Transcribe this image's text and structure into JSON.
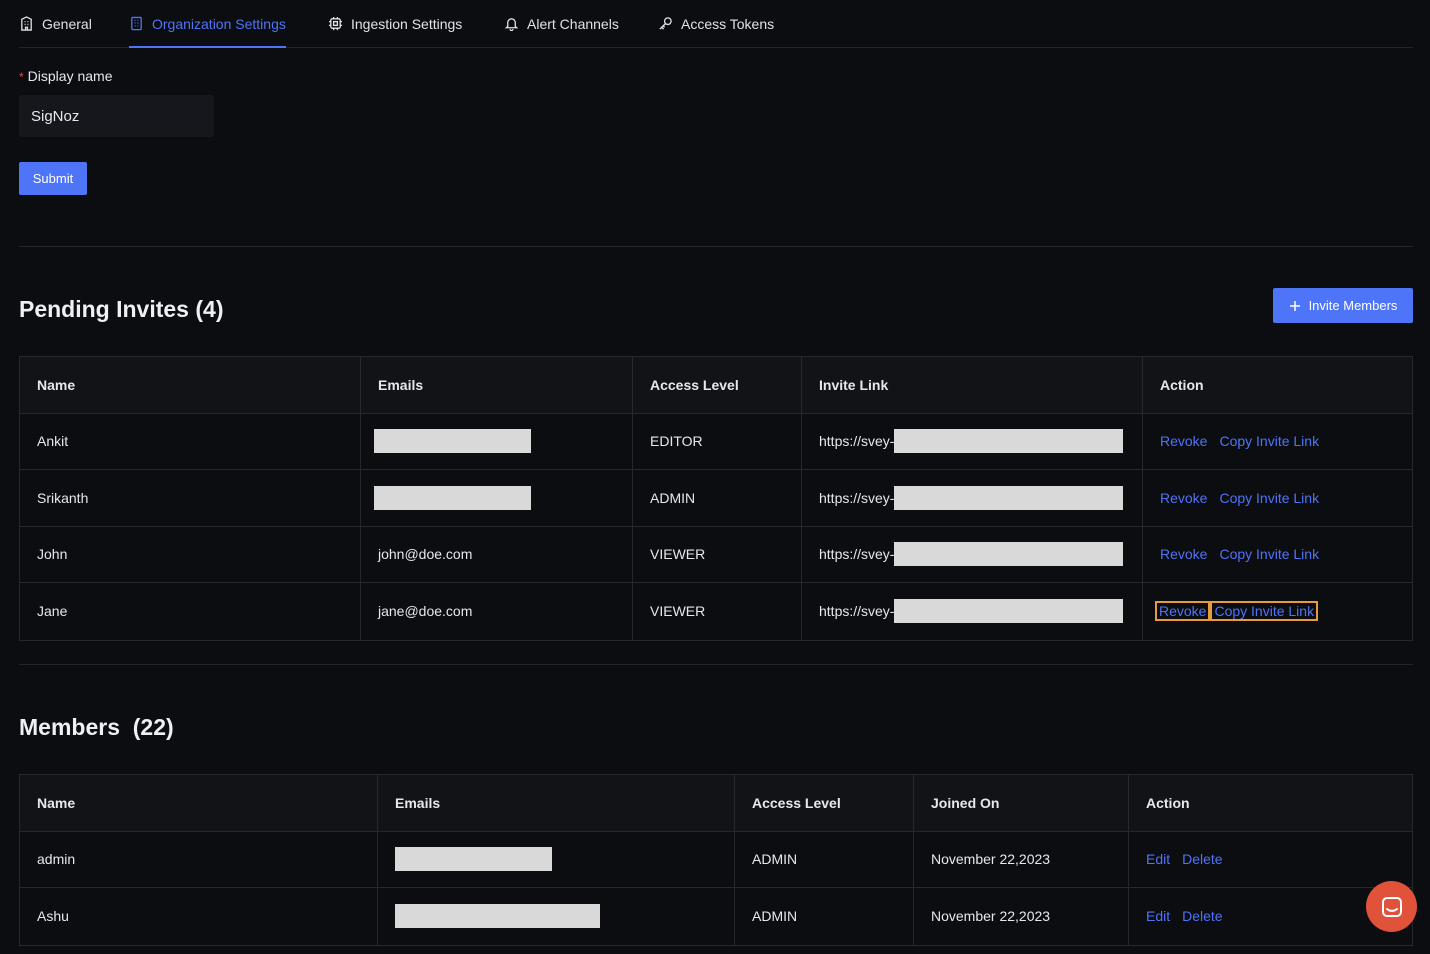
{
  "tabs": [
    {
      "label": "General",
      "icon": "building-icon"
    },
    {
      "label": "Organization Settings",
      "icon": "building-grid-icon"
    },
    {
      "label": "Ingestion Settings",
      "icon": "chip-icon"
    },
    {
      "label": "Alert Channels",
      "icon": "bell-icon"
    },
    {
      "label": "Access Tokens",
      "icon": "key-icon"
    }
  ],
  "org_form": {
    "required_mark": "*",
    "label": "Display name",
    "value": "SigNoz",
    "submit_label": "Submit"
  },
  "pending": {
    "title": "Pending Invites",
    "count": "(4)",
    "invite_button": "Invite Members",
    "columns": [
      "Name",
      "Emails",
      "Access Level",
      "Invite Link",
      "Action"
    ],
    "rows": [
      {
        "name": "Ankit",
        "email": "",
        "level": "EDITOR",
        "link_prefix": "https://svey-",
        "revoke": "Revoke",
        "copy": "Copy Invite Link"
      },
      {
        "name": "Srikanth",
        "email": "",
        "level": "ADMIN",
        "link_prefix": "https://svey-",
        "revoke": "Revoke",
        "copy": "Copy Invite Link"
      },
      {
        "name": "John",
        "email": "john@doe.com",
        "level": "VIEWER",
        "link_prefix": "https://svey-",
        "revoke": "Revoke",
        "copy": "Copy Invite Link"
      },
      {
        "name": "Jane",
        "email": "jane@doe.com",
        "level": "VIEWER",
        "link_prefix": "https://svey-",
        "revoke": "Revoke",
        "copy": "Copy Invite Link"
      }
    ]
  },
  "members": {
    "title": "Members",
    "count": "(22)",
    "columns": [
      "Name",
      "Emails",
      "Access Level",
      "Joined On",
      "Action"
    ],
    "rows": [
      {
        "name": "admin",
        "email": "",
        "level": "ADMIN",
        "joined": "November 22,2023",
        "edit": "Edit",
        "delete": "Delete"
      },
      {
        "name": "Ashu",
        "email": "",
        "level": "ADMIN",
        "joined": "November 22,2023",
        "edit": "Edit",
        "delete": "Delete"
      }
    ]
  },
  "colors": {
    "accent": "#4e74f8",
    "background": "#0c0d11",
    "chat": "#e0533a",
    "focus": "#e89a3c"
  }
}
